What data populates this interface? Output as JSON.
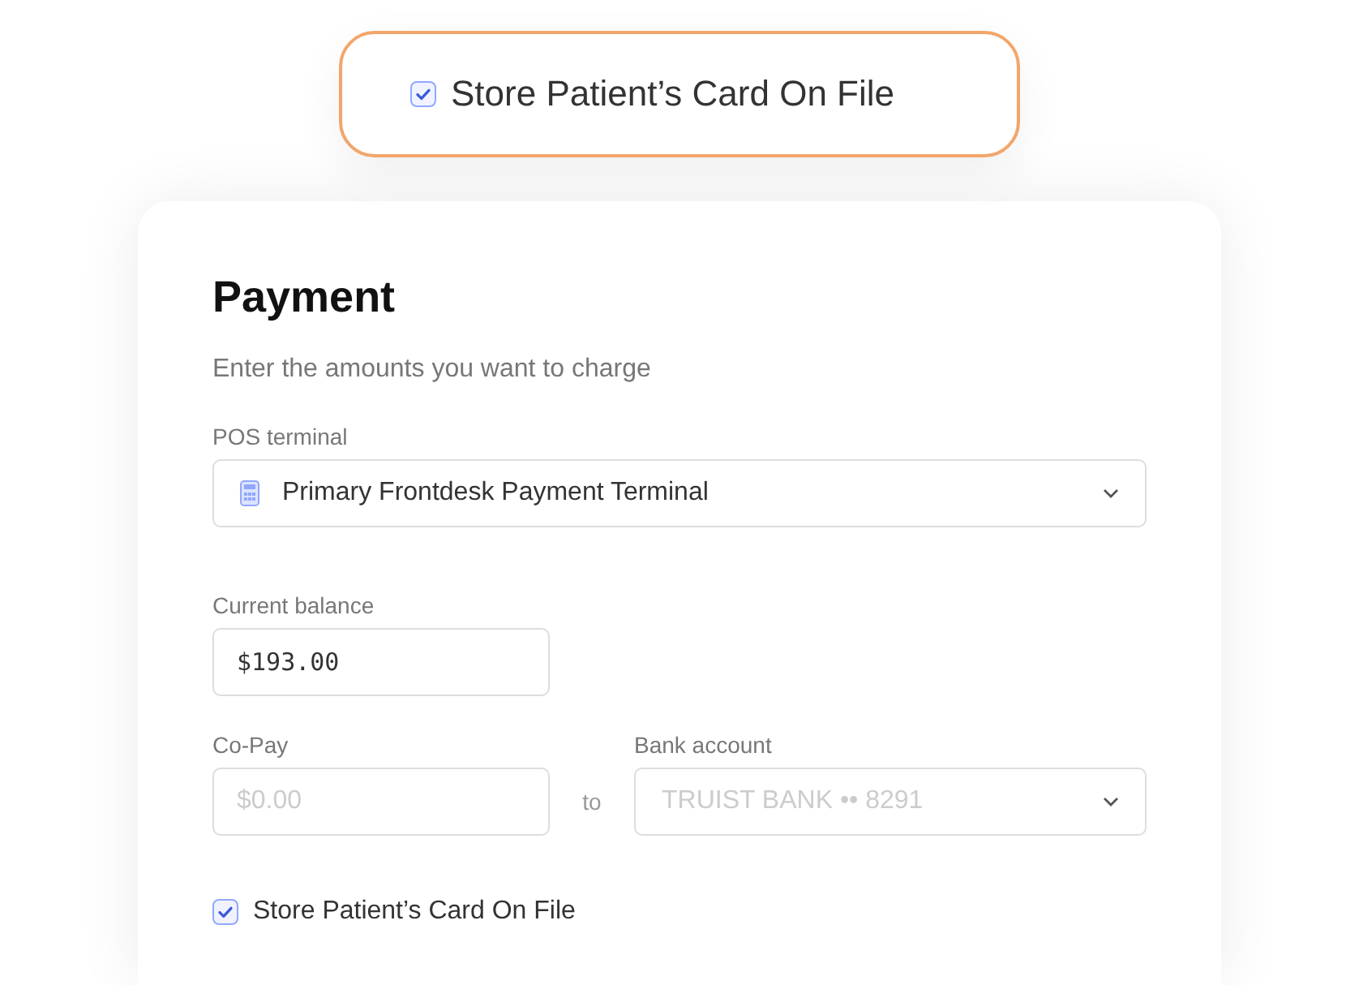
{
  "callout": {
    "label": "Store Patient’s Card On File",
    "checked": true
  },
  "payment": {
    "title": "Payment",
    "subtitle": "Enter the amounts you want to charge",
    "pos_terminal": {
      "label": "POS terminal",
      "value": "Primary Frontdesk Payment Terminal"
    },
    "current_balance": {
      "label": "Current balance",
      "value": "$193.00"
    },
    "co_pay": {
      "label": "Co-Pay",
      "placeholder": "$0.00"
    },
    "connector": "to",
    "bank_account": {
      "label": "Bank account",
      "placeholder": "TRUIST BANK •• 8291"
    },
    "store_card": {
      "label": "Store Patient’s Card On File",
      "checked": true
    }
  }
}
